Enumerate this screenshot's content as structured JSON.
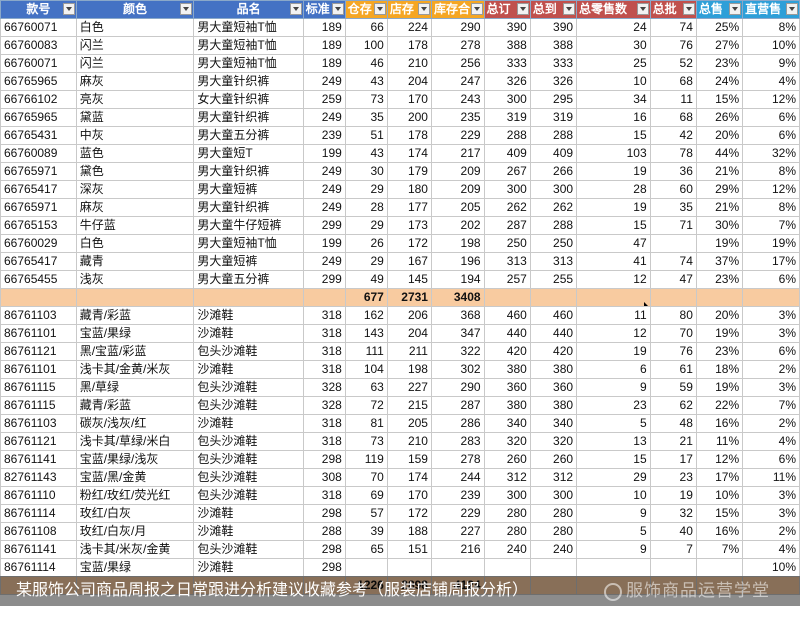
{
  "headers": [
    {
      "label": "款号",
      "bg": "#4472c4"
    },
    {
      "label": "颜色",
      "bg": "#4472c4"
    },
    {
      "label": "品名",
      "bg": "#4472c4"
    },
    {
      "label": "标准",
      "bg": "#4472c4"
    },
    {
      "label": "仓存",
      "bg": "#f5a623"
    },
    {
      "label": "店存",
      "bg": "#f5a623"
    },
    {
      "label": "库存合",
      "bg": "#f5a623"
    },
    {
      "label": "总订",
      "bg": "#c0504d"
    },
    {
      "label": "总到",
      "bg": "#c0504d"
    },
    {
      "label": "总零售数",
      "bg": "#c0504d"
    },
    {
      "label": "总批",
      "bg": "#c0504d"
    },
    {
      "label": "总售",
      "bg": "#2e9fd8"
    },
    {
      "label": "直营售",
      "bg": "#2e9fd8"
    }
  ],
  "group1": [
    [
      "66760071",
      "白色",
      "男大童短袖T恤",
      "189",
      "66",
      "224",
      "290",
      "390",
      "390",
      "24",
      "74",
      "25%",
      "8%"
    ],
    [
      "66760083",
      "闪兰",
      "男大童短袖T恤",
      "189",
      "100",
      "178",
      "278",
      "388",
      "388",
      "30",
      "76",
      "27%",
      "10%"
    ],
    [
      "66760071",
      "闪兰",
      "男大童短袖T恤",
      "189",
      "46",
      "210",
      "256",
      "333",
      "333",
      "25",
      "52",
      "23%",
      "9%"
    ],
    [
      "66765965",
      "麻灰",
      "男大童针织裤",
      "249",
      "43",
      "204",
      "247",
      "326",
      "326",
      "10",
      "68",
      "24%",
      "4%"
    ],
    [
      "66766102",
      "亮灰",
      "女大童针织裤",
      "259",
      "73",
      "170",
      "243",
      "300",
      "295",
      "34",
      "11",
      "15%",
      "12%"
    ],
    [
      "66765965",
      "黛蓝",
      "男大童针织裤",
      "249",
      "35",
      "200",
      "235",
      "319",
      "319",
      "16",
      "68",
      "26%",
      "6%"
    ],
    [
      "66765431",
      "中灰",
      "男大童五分裤",
      "239",
      "51",
      "178",
      "229",
      "288",
      "288",
      "15",
      "42",
      "20%",
      "6%"
    ],
    [
      "66760089",
      "蓝色",
      "男大童短T",
      "199",
      "43",
      "174",
      "217",
      "409",
      "409",
      "103",
      "78",
      "44%",
      "32%"
    ],
    [
      "66765971",
      "黛色",
      "男大童针织裤",
      "249",
      "30",
      "179",
      "209",
      "267",
      "266",
      "19",
      "36",
      "21%",
      "8%"
    ],
    [
      "66765417",
      "深灰",
      "男大童短裤",
      "249",
      "29",
      "180",
      "209",
      "300",
      "300",
      "28",
      "60",
      "29%",
      "12%"
    ],
    [
      "66765971",
      "麻灰",
      "男大童针织裤",
      "249",
      "28",
      "177",
      "205",
      "262",
      "262",
      "19",
      "35",
      "21%",
      "8%"
    ],
    [
      "66765153",
      "牛仔蓝",
      "男大童牛仔短裤",
      "299",
      "29",
      "173",
      "202",
      "287",
      "288",
      "15",
      "71",
      "30%",
      "7%"
    ],
    [
      "66760029",
      "白色",
      "男大童短袖T恤",
      "199",
      "26",
      "172",
      "198",
      "250",
      "250",
      "47",
      "",
      "19%",
      "19%"
    ],
    [
      "66765417",
      "藏青",
      "男大童短裤",
      "249",
      "29",
      "167",
      "196",
      "313",
      "313",
      "41",
      "74",
      "37%",
      "17%"
    ],
    [
      "66765455",
      "浅灰",
      "男大童五分裤",
      "299",
      "49",
      "145",
      "194",
      "257",
      "255",
      "12",
      "47",
      "23%",
      "6%"
    ]
  ],
  "sum1": {
    "cang": "677",
    "dian": "2731",
    "total": "3408"
  },
  "group2": [
    [
      "86761103",
      "藏青/彩蓝",
      "沙滩鞋",
      "318",
      "162",
      "206",
      "368",
      "460",
      "460",
      "11",
      "80",
      "20%",
      "3%"
    ],
    [
      "86761101",
      "宝蓝/果绿",
      "沙滩鞋",
      "318",
      "143",
      "204",
      "347",
      "440",
      "440",
      "12",
      "70",
      "19%",
      "3%"
    ],
    [
      "86761121",
      "黑/宝蓝/彩蓝",
      "包头沙滩鞋",
      "318",
      "111",
      "211",
      "322",
      "420",
      "420",
      "19",
      "76",
      "23%",
      "6%"
    ],
    [
      "86761101",
      "浅卡其/金黄/米灰",
      "沙滩鞋",
      "318",
      "104",
      "198",
      "302",
      "380",
      "380",
      "6",
      "61",
      "18%",
      "2%"
    ],
    [
      "86761115",
      "黑/草绿",
      "包头沙滩鞋",
      "328",
      "63",
      "227",
      "290",
      "360",
      "360",
      "9",
      "59",
      "19%",
      "3%"
    ],
    [
      "86761115",
      "藏青/彩蓝",
      "包头沙滩鞋",
      "328",
      "72",
      "215",
      "287",
      "380",
      "380",
      "23",
      "62",
      "22%",
      "7%"
    ],
    [
      "86761103",
      "碳灰/浅灰/红",
      "沙滩鞋",
      "318",
      "81",
      "205",
      "286",
      "340",
      "340",
      "5",
      "48",
      "16%",
      "2%"
    ],
    [
      "86761121",
      "浅卡其/草绿/米白",
      "包头沙滩鞋",
      "318",
      "73",
      "210",
      "283",
      "320",
      "320",
      "13",
      "21",
      "11%",
      "4%"
    ],
    [
      "86761141",
      "宝蓝/果绿/浅灰",
      "包头沙滩鞋",
      "298",
      "119",
      "159",
      "278",
      "260",
      "260",
      "15",
      "17",
      "12%",
      "6%"
    ],
    [
      "82761143",
      "宝蓝/黑/金黄",
      "包头沙滩鞋",
      "308",
      "70",
      "174",
      "244",
      "312",
      "312",
      "29",
      "23",
      "17%",
      "11%"
    ],
    [
      "86761110",
      "粉红/玫红/荧光红",
      "包头沙滩鞋",
      "318",
      "69",
      "170",
      "239",
      "300",
      "300",
      "10",
      "19",
      "10%",
      "3%"
    ],
    [
      "86761114",
      "玫红/白灰",
      "沙滩鞋",
      "298",
      "57",
      "172",
      "229",
      "280",
      "280",
      "9",
      "32",
      "15%",
      "3%"
    ],
    [
      "86761108",
      "玫红/白灰/月",
      "沙滩鞋",
      "288",
      "39",
      "188",
      "227",
      "280",
      "280",
      "5",
      "40",
      "16%",
      "2%"
    ],
    [
      "86761141",
      "浅卡其/米灰/金黄",
      "包头沙滩鞋",
      "298",
      "65",
      "151",
      "216",
      "240",
      "240",
      "9",
      "7",
      "7%",
      "4%"
    ],
    [
      "86761114",
      "宝蓝/果绿",
      "沙滩鞋",
      "298",
      "",
      "",
      "",
      "",
      "",
      "",
      "",
      "",
      "10%"
    ]
  ],
  "sum2": {
    "cang": "1226",
    "dian": "2898",
    "total": "4124"
  },
  "caption": "某服饰公司商品周报之日常跟进分析建议收藏参考（服装店铺周报分析）",
  "watermark": "服饰商品运营学堂"
}
